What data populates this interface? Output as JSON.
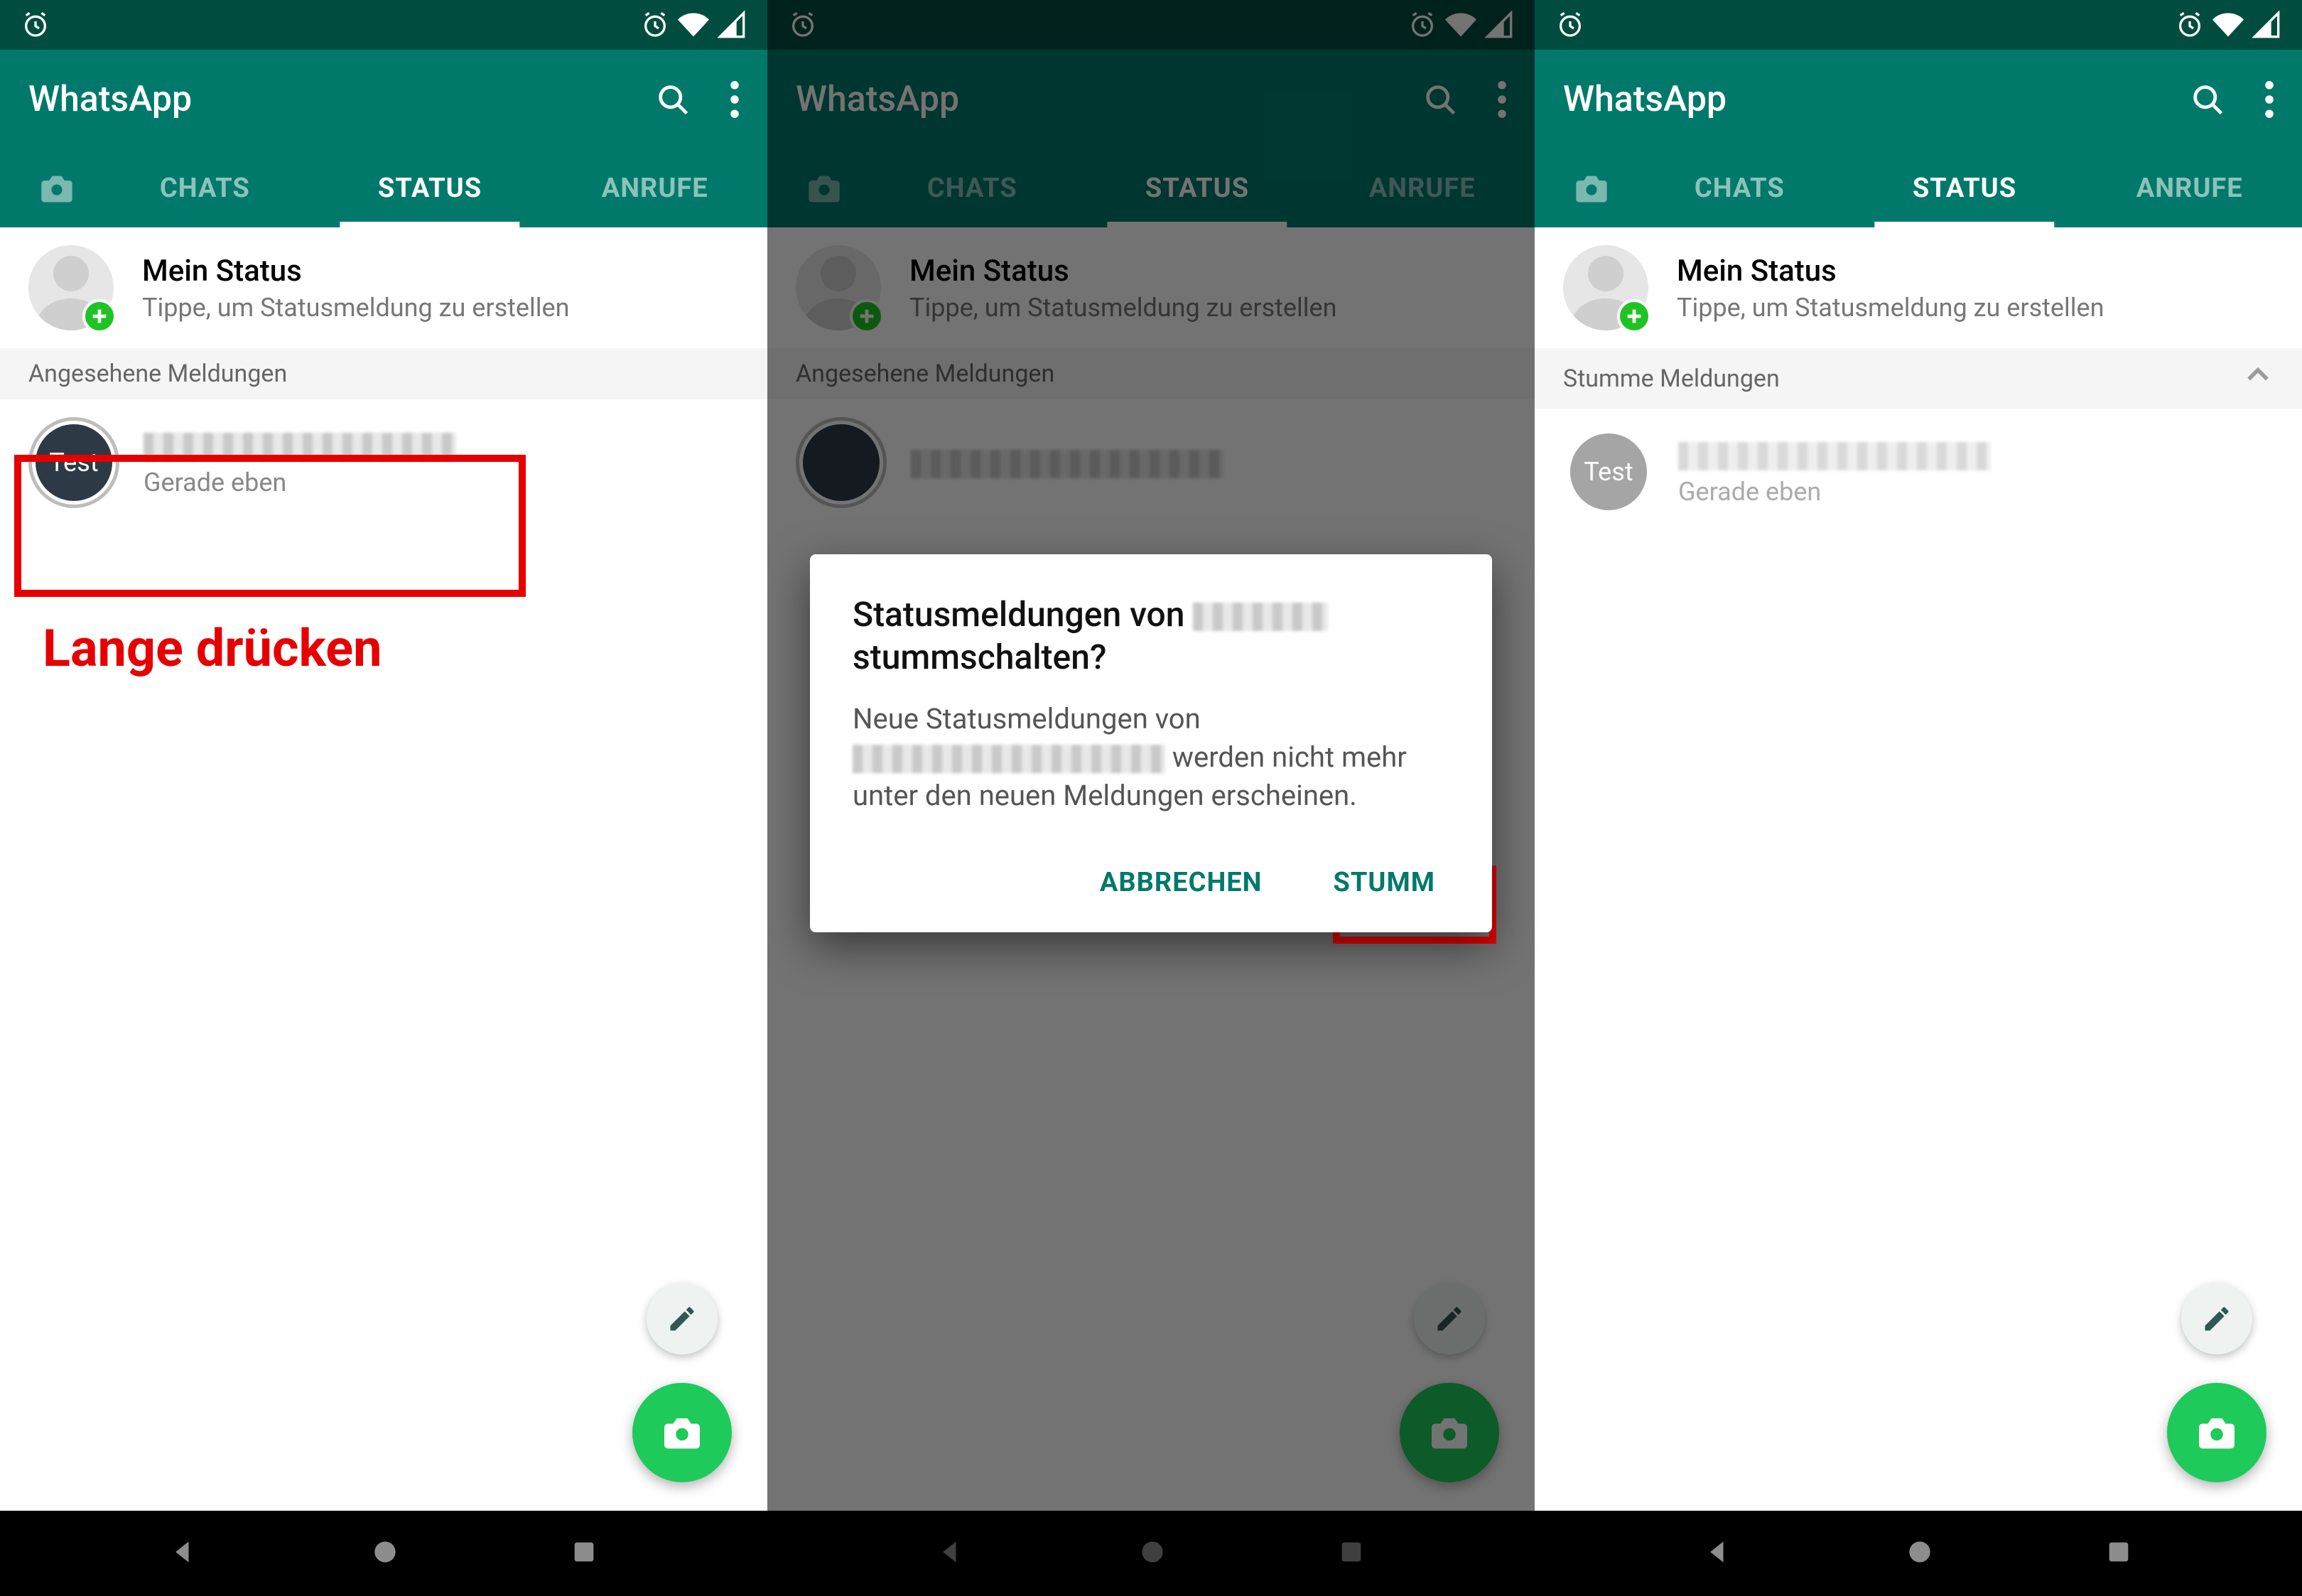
{
  "app": {
    "title": "WhatsApp"
  },
  "tabs": {
    "chats": "CHATS",
    "status": "STATUS",
    "anrufe": "ANRUFE"
  },
  "my_status": {
    "title": "Mein Status",
    "subtitle": "Tippe, um Statusmeldung zu erstellen"
  },
  "section_seen": "Angesehene Meldungen",
  "section_muted": "Stumme Meldungen",
  "status_item": {
    "thumb_text": "Test",
    "time": "Gerade eben"
  },
  "annotation": {
    "long_press": "Lange drücken"
  },
  "dialog": {
    "title_1": "Statusmeldungen von",
    "title_2": "stummschalten?",
    "body_1": "Neue Statusmeldungen von",
    "body_2": "werden nicht mehr unter den neuen Meldungen erscheinen.",
    "cancel": "ABBRECHEN",
    "mute": "STUMM"
  }
}
